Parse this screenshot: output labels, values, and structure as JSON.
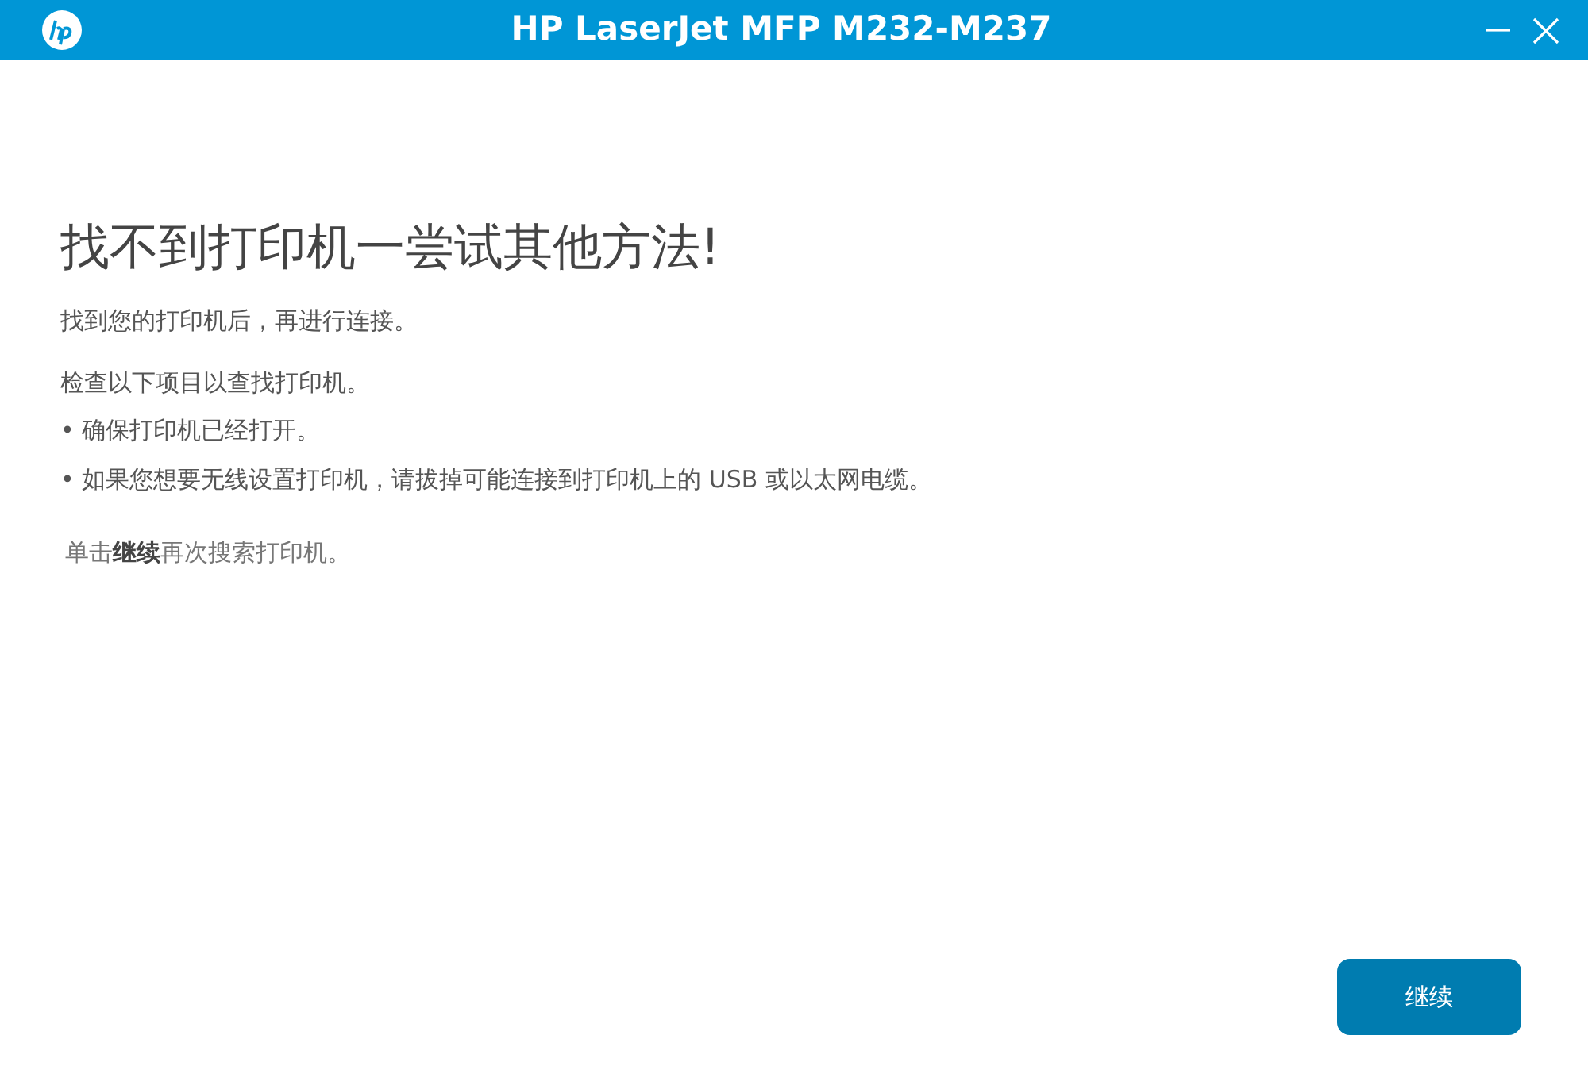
{
  "window": {
    "title": "HP LaserJet MFP M232-M237"
  },
  "heading": "找不到打印机一尝试其他方法!",
  "intro": "找到您的打印机后，再进行连接。",
  "check_intro": "检查以下项目以查找打印机。",
  "checks": [
    "• 确保打印机已经打开。",
    "• 如果您想要无线设置打印机，请拔掉可能连接到打印机上的 USB 或以太网电缆。"
  ],
  "hint": "单击**继续**再次搜索打印机。",
  "buttons": [
    "继续"
  ]
}
